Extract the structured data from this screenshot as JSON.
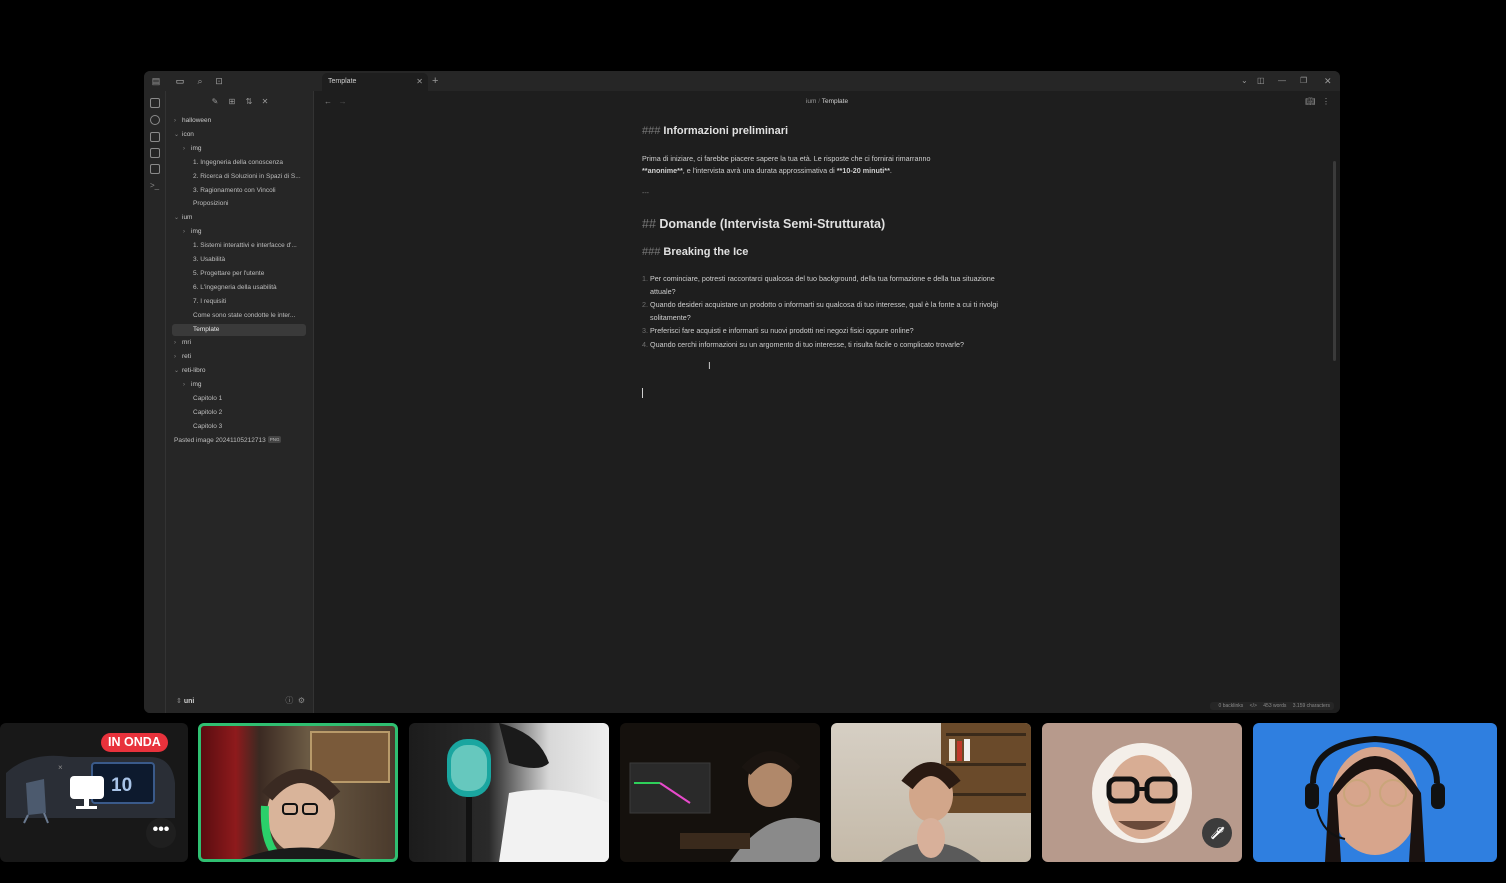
{
  "editor": {
    "tab_title": "Template",
    "breadcrumb": {
      "folder": "ium",
      "separator": "/",
      "current": "Template"
    },
    "vault_name": "uni",
    "status": {
      "backlinks": "0 backlinks",
      "words": "453 words",
      "characters": "3.159 characters"
    }
  },
  "file_tree": [
    {
      "label": "halloween",
      "type": "folder",
      "depth": 0,
      "collapsed": true
    },
    {
      "label": "icon",
      "type": "folder",
      "depth": 0,
      "collapsed": false
    },
    {
      "label": "img",
      "type": "folder",
      "depth": 1,
      "collapsed": true
    },
    {
      "label": "1. Ingegneria della conoscenza",
      "type": "file",
      "depth": 1
    },
    {
      "label": "2. Ricerca di Soluzioni in Spazi di S...",
      "type": "file",
      "depth": 1
    },
    {
      "label": "3. Ragionamento con Vincoli",
      "type": "file",
      "depth": 1
    },
    {
      "label": "Proposizioni",
      "type": "file",
      "depth": 1
    },
    {
      "label": "ium",
      "type": "folder",
      "depth": 0,
      "collapsed": false
    },
    {
      "label": "img",
      "type": "folder",
      "depth": 1,
      "collapsed": true
    },
    {
      "label": "1. Sistemi interattivi e interfacce d'...",
      "type": "file",
      "depth": 1
    },
    {
      "label": "3. Usabilità",
      "type": "file",
      "depth": 1
    },
    {
      "label": "5. Progettare per l'utente",
      "type": "file",
      "depth": 1
    },
    {
      "label": "6. L'ingegneria della usabilità",
      "type": "file",
      "depth": 1
    },
    {
      "label": "7.  I requisiti",
      "type": "file",
      "depth": 1
    },
    {
      "label": "Come sono state condotte le inter...",
      "type": "file",
      "depth": 1
    },
    {
      "label": "Template",
      "type": "file",
      "depth": 1,
      "active": true
    },
    {
      "label": "mri",
      "type": "folder",
      "depth": 0,
      "collapsed": true
    },
    {
      "label": "reti",
      "type": "folder",
      "depth": 0,
      "collapsed": true
    },
    {
      "label": "reti-libro",
      "type": "folder",
      "depth": 0,
      "collapsed": false
    },
    {
      "label": "img",
      "type": "folder",
      "depth": 1,
      "collapsed": true
    },
    {
      "label": "Capitolo 1",
      "type": "file",
      "depth": 1
    },
    {
      "label": "Capitolo 2",
      "type": "file",
      "depth": 1
    },
    {
      "label": "Capitolo 3",
      "type": "file",
      "depth": 1
    },
    {
      "label": "Pasted image 20241105212713",
      "type": "file",
      "depth": 0,
      "badge": "PNG"
    }
  ],
  "document": {
    "h_prelim_hash": "###",
    "h_prelim": "Informazioni preliminari",
    "intro_a": "Prima di iniziare, ci farebbe piacere sapere la tua età. Le risposte che ci fornirai rimarranno",
    "intro_b1": "**anonime**",
    "intro_b2": ", e l'intervista avrà una durata approssimativa di ",
    "intro_b3": "**10-20 minuti**",
    "intro_b4": ".",
    "separator": "---",
    "h_domande_hash": "##",
    "h_domande": "Domande (Intervista Semi-Strutturata)",
    "h_ice_hash": "###",
    "h_ice": "Breaking the Ice",
    "questions": [
      {
        "num": "1.",
        "text": "Per cominciare, potresti raccontarci qualcosa del tuo background, della tua formazione e della tua situazione attuale?"
      },
      {
        "num": "2.",
        "text": "Quando desideri acquistare un prodotto o informarti su qualcosa di tuo interesse, qual è la fonte a cui ti rivolgi solitamente?"
      },
      {
        "num": "3.",
        "text": "Preferisci fare acquisti e informarti su nuovi prodotti nei negozi fisici oppure online?"
      },
      {
        "num": "4.",
        "text": "Quando cerchi informazioni su un argomento di tuo interesse, ti risulta facile o complicato trovarle?"
      }
    ]
  },
  "call": {
    "live_badge": "IN ONDA",
    "screen_number": "10",
    "more_label": "•••",
    "muted_icon": "microphone-off-icon"
  }
}
